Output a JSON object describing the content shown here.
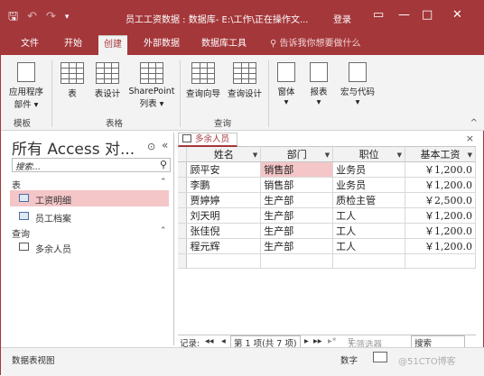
{
  "titlebar": {
    "title": "员工工资数据 : 数据库- E:\\工作\\正在操作文...",
    "login": "登录",
    "save_icon": "save-icon",
    "undo_icon": "undo-icon",
    "redo_icon": "redo-icon",
    "qat_more_icon": "qat-dropdown-icon",
    "minimize": "—",
    "maximize": "□",
    "close": "✕"
  },
  "tabs": [
    {
      "label": "文件"
    },
    {
      "label": "开始"
    },
    {
      "label": "创建"
    },
    {
      "label": "外部数据"
    },
    {
      "label": "数据库工具"
    }
  ],
  "tell_me": "告诉我你想要做什么",
  "ribbon": {
    "buttons": {
      "app_parts": "应用程序\n部件 ▾",
      "table": "表",
      "table_design": "表设计",
      "sharepoint": "SharePoint\n列表 ▾",
      "query_wizard": "查询向导",
      "query_design": "查询设计",
      "form": "窗体\n▾",
      "report": "报表\n▾",
      "macro_code": "宏与代码\n▾"
    },
    "groups": {
      "templates": "模板",
      "tables": "表格",
      "queries": "查询"
    },
    "collapse_icon": "^"
  },
  "nav": {
    "title": "所有 Access 对...",
    "search_placeholder": "搜索...",
    "sections": {
      "tables": "表",
      "queries": "查询"
    },
    "items": {
      "t1": "工资明细",
      "t2": "员工档案",
      "q1": "多余人员"
    }
  },
  "document": {
    "tab": "多余人员",
    "close": "×",
    "columns": [
      "姓名",
      "部门",
      "职位",
      "基本工资"
    ],
    "rows": [
      [
        "顾平安",
        "销售部",
        "业务员",
        "￥1,200.0"
      ],
      [
        "李鹏",
        "销售部",
        "业务员",
        "￥1,200.0"
      ],
      [
        "贾婷婷",
        "生产部",
        "质检主管",
        "￥2,500.0"
      ],
      [
        "刘天明",
        "生产部",
        "工人",
        "￥1,200.0"
      ],
      [
        "张佳倪",
        "生产部",
        "工人",
        "￥1,200.0"
      ],
      [
        "程元辉",
        "生产部",
        "工人",
        "￥1,200.0"
      ]
    ]
  },
  "recnav": {
    "label": "记录:",
    "first": "◂◂",
    "prev": "◂",
    "position": "第 1 项(共 7 项)",
    "next": "▸",
    "last": "▸▸",
    "new": "▸*",
    "filter": "无筛选器",
    "search": "搜索"
  },
  "status": {
    "view": "数据表视图",
    "numlock": "数字",
    "watermark": "@51CTO博客"
  }
}
